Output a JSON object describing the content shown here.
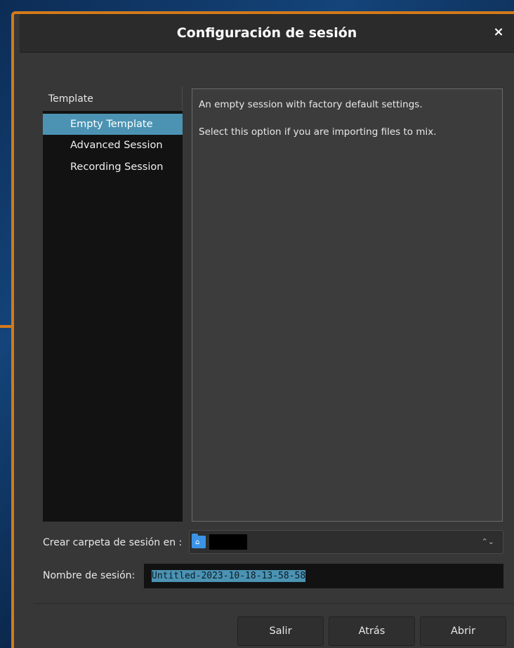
{
  "window": {
    "title": "Configuración de sesión",
    "close_icon": "×"
  },
  "templates": {
    "header": "Template",
    "items": [
      {
        "label": "Empty Template",
        "selected": true
      },
      {
        "label": "Advanced Session",
        "selected": false
      },
      {
        "label": "Recording Session",
        "selected": false
      }
    ]
  },
  "description": {
    "line1": "An empty session with factory default settings.",
    "line2": "Select this option if you are importing files to mix."
  },
  "folder": {
    "label": "Crear carpeta de sesión en :",
    "icon": "home-folder-icon",
    "spinner_icon": "⌃⌄"
  },
  "session_name": {
    "label": "Nombre de sesión:",
    "value": "Untitled-2023-10-18-13-58-58"
  },
  "buttons": {
    "quit": "Salir",
    "back": "Atrás",
    "open": "Abrir"
  },
  "colors": {
    "accent_border": "#d27a1a",
    "selection": "#4c93b3",
    "folder_icon": "#3b93e6"
  }
}
